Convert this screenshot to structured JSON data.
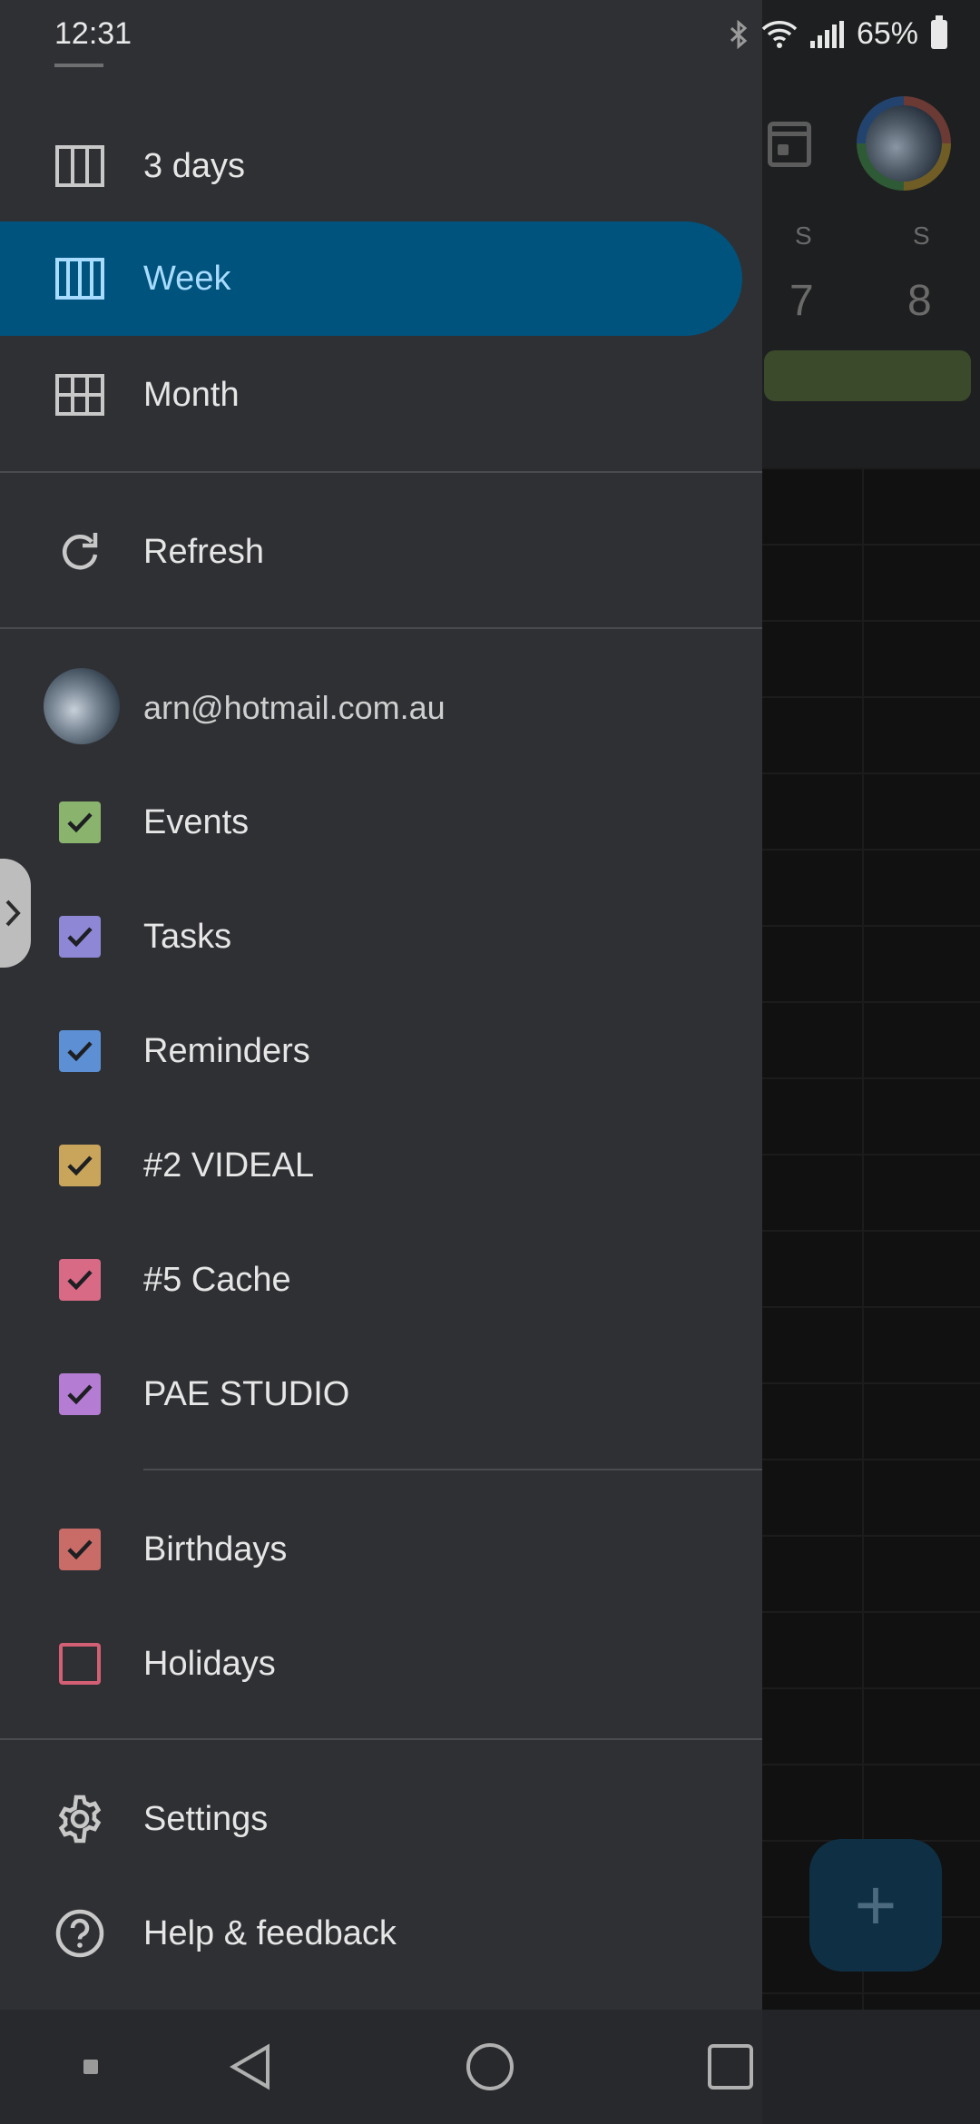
{
  "status_bar": {
    "time": "12:31",
    "battery": "65%"
  },
  "background_calendar": {
    "day_labels": [
      "S",
      "S"
    ],
    "day_numbers": [
      "7",
      "8"
    ],
    "fab_label": "+"
  },
  "drawer": {
    "views": [
      {
        "label": "3 days",
        "icon": "three-column-icon",
        "selected": false
      },
      {
        "label": "Week",
        "icon": "week-columns-icon",
        "selected": true
      },
      {
        "label": "Month",
        "icon": "grid-icon",
        "selected": false
      }
    ],
    "refresh_label": "Refresh",
    "account": "arn@hotmail.com.au",
    "calendars": [
      {
        "label": "Events",
        "color": "#8ab46e",
        "checked": true
      },
      {
        "label": "Tasks",
        "color": "#8e87d6",
        "checked": true
      },
      {
        "label": "Reminders",
        "color": "#5c8fd4",
        "checked": true
      },
      {
        "label": "#2 VIDEAL",
        "color": "#c9a55c",
        "checked": true
      },
      {
        "label": "#5 Cache",
        "color": "#d86a86",
        "checked": true
      },
      {
        "label": "PAE STUDIO",
        "color": "#b47cd2",
        "checked": true
      }
    ],
    "other_calendars": [
      {
        "label": "Birthdays",
        "color": "#c96c68",
        "checked": true
      },
      {
        "label": "Holidays",
        "color": "#d35f74",
        "checked": false
      }
    ],
    "settings_label": "Settings",
    "help_label": "Help & feedback"
  },
  "colors": {
    "drawer_bg": "#2f3034",
    "selected_bg": "#00537d",
    "selected_text": "#a8dcff"
  }
}
